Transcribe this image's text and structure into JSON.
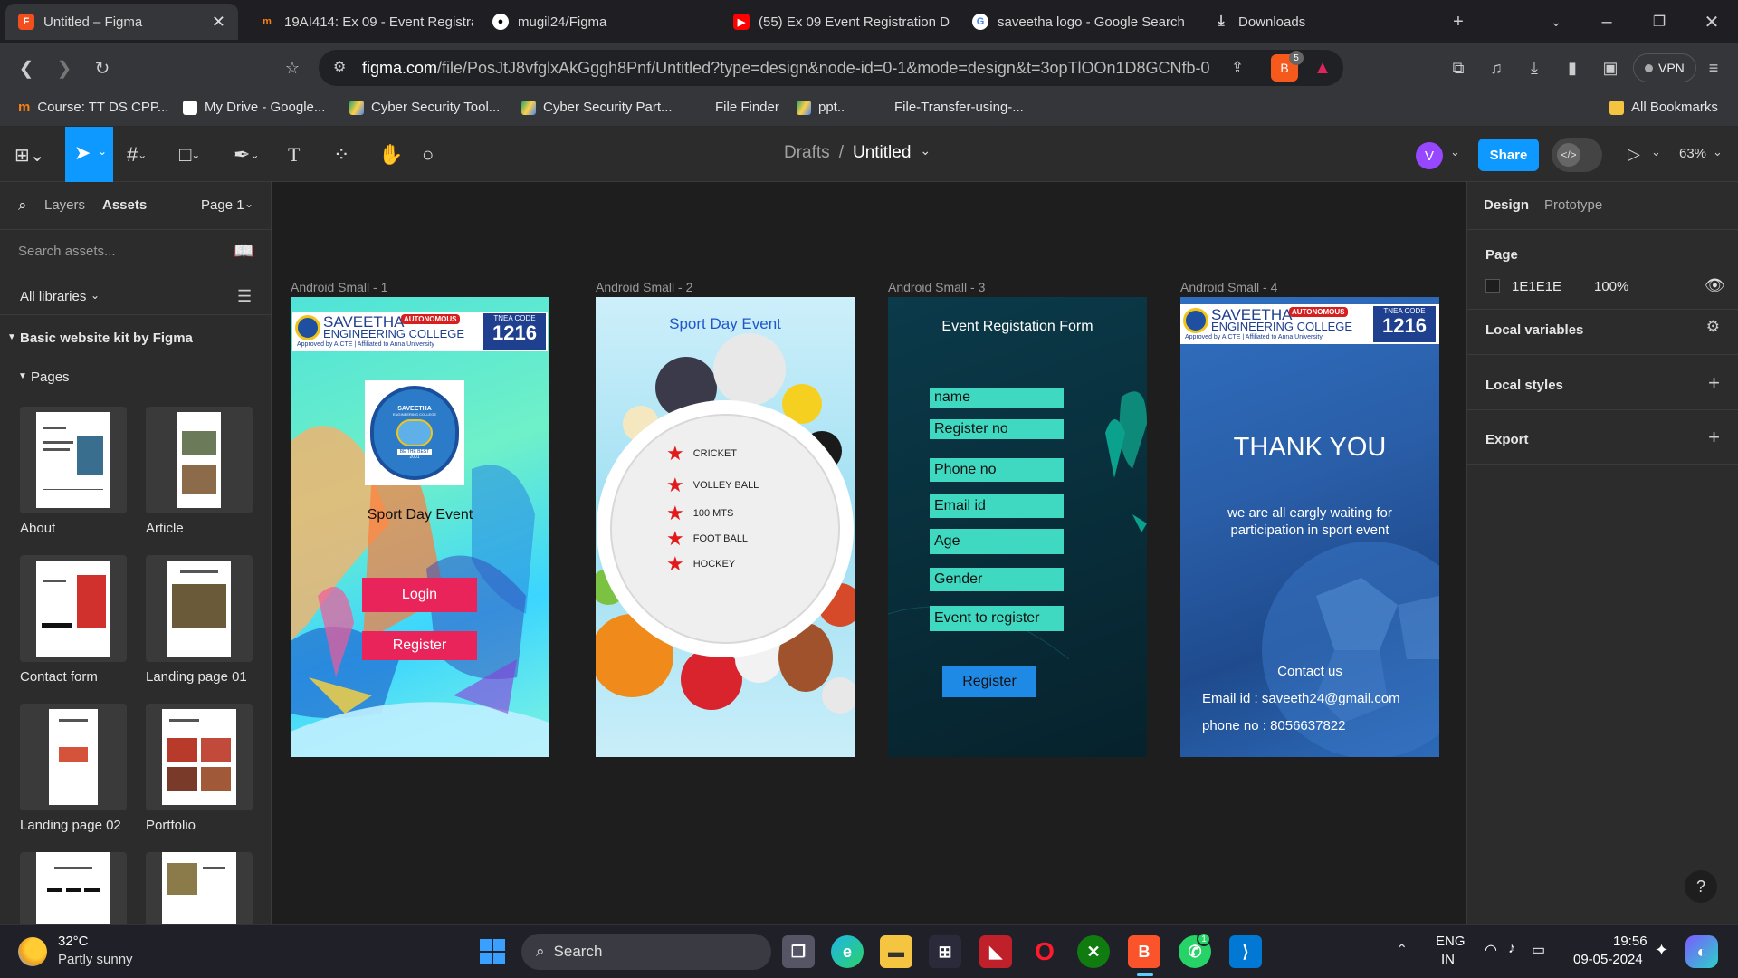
{
  "browser": {
    "tabs": [
      {
        "title": "Untitled – Figma",
        "active": true
      },
      {
        "title": "19AI414: Ex 09 - Event Registrat"
      },
      {
        "title": "mugil24/Figma"
      },
      {
        "title": "(55) Ex 09 Event Registration D"
      },
      {
        "title": "saveetha logo - Google Search"
      },
      {
        "title": "Downloads"
      }
    ],
    "url_domain": "figma.com",
    "url_path": "/file/PosJtJ8vfglxAkGggh8Pnf/Untitled?type=design&node-id=0-1&mode=design&t=3opTlOOn1D8GCNfb-0",
    "brave_badge": "5",
    "vpn_label": "VPN",
    "bookmarks": [
      "Course: TT DS CPP...",
      "My Drive - Google...",
      "Cyber Security Tool...",
      "Cyber Security Part...",
      "File Finder",
      "ppt..",
      "File-Transfer-using-...",
      "All Bookmarks"
    ]
  },
  "figma": {
    "breadcrumb_parent": "Drafts",
    "breadcrumb_sep": "/",
    "file_name": "Untitled",
    "avatar_letter": "V",
    "share_label": "Share",
    "zoom": "63%",
    "left": {
      "tab_layers": "Layers",
      "tab_assets": "Assets",
      "page_select": "Page 1",
      "search_placeholder": "Search assets...",
      "libraries": "All libraries",
      "kit_title": "Basic website kit by Figma",
      "pages_heading": "Pages",
      "page_thumbs": [
        "About",
        "Article",
        "Contact form",
        "Landing page 01",
        "Landing page 02",
        "Portfolio"
      ]
    },
    "right": {
      "tab_design": "Design",
      "tab_prototype": "Prototype",
      "page_heading": "Page",
      "bg_hex": "1E1E1E",
      "bg_opacity": "100%",
      "local_variables": "Local variables",
      "local_styles": "Local styles",
      "export": "Export",
      "help": "?"
    },
    "frames": [
      {
        "label": "Android Small - 1",
        "college": "SAVEETHA",
        "college2": "ENGINEERING COLLEGE",
        "autonomous": "AUTONOMOUS",
        "tnea": "TNEA CODE",
        "code": "1216",
        "approved": "Approved by AICTE | Affiliated to Anna University",
        "seal_top": "SAVEETHA",
        "seal_sub": "ENGINEERING COLLEGE",
        "seal_motto": "BE THE BEST",
        "seal_year": "2001",
        "event": "Sport Day Event",
        "login": "Login",
        "register": "Register"
      },
      {
        "label": "Android Small - 2",
        "title": "Sport Day Event",
        "sports": [
          "CRICKET",
          "VOLLEY BALL",
          "100 MTS",
          "FOOT BALL",
          "HOCKEY"
        ]
      },
      {
        "label": "Android Small - 3",
        "title": "Event Registation Form",
        "fields": [
          "name",
          "Register no",
          "Phone no",
          "Email id",
          "Age",
          "Gender",
          "Event to register"
        ],
        "register": "Register"
      },
      {
        "label": "Android Small - 4",
        "college": "SAVEETHA",
        "college2": "ENGINEERING COLLEGE",
        "autonomous": "AUTONOMOUS",
        "tnea": "TNEA CODE",
        "code": "1216",
        "approved": "Approved by AICTE | Affiliated to Anna University",
        "thank": "THANK YOU",
        "msg1": "we are all eargly waiting for",
        "msg2": "participation in sport event",
        "contact": "Contact us",
        "email": "Email id : saveeth24@gmail.com",
        "phone": "phone no : 8056637822"
      }
    ]
  },
  "taskbar": {
    "weather_temp": "32°C",
    "weather_desc": "Partly sunny",
    "search": "Search",
    "lang1": "ENG",
    "lang2": "IN",
    "time": "19:56",
    "date": "09-05-2024",
    "whatsapp_badge": "1"
  }
}
